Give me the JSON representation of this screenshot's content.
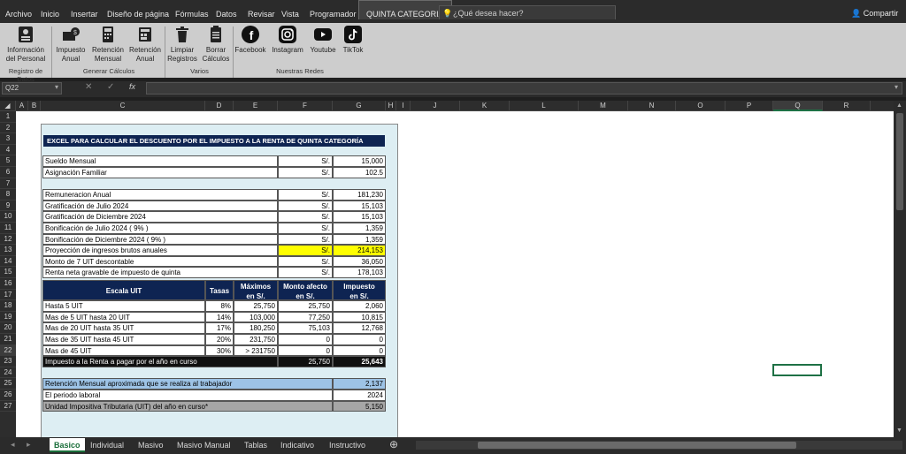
{
  "menubar": {
    "items": [
      "Archivo",
      "Inicio",
      "Insertar",
      "Diseño de página",
      "Fórmulas",
      "Datos",
      "Revisar",
      "Vista",
      "Programador",
      "QUINTA CATEGORIA"
    ],
    "search_placeholder": "¿Qué desea hacer?",
    "share_label": "Compartir"
  },
  "ribbon": {
    "buttons": [
      {
        "label1": "Información",
        "label2": "del Personal",
        "icon": "id-card-icon"
      },
      {
        "label1": "Impuesto",
        "label2": "Anual",
        "icon": "money-icon"
      },
      {
        "label1": "Retención",
        "label2": "Mensual",
        "icon": "calculator-icon"
      },
      {
        "label1": "Retención",
        "label2": "Anual",
        "icon": "calculator-stack-icon"
      },
      {
        "label1": "Limpiar",
        "label2": "Registros",
        "icon": "trash-icon"
      },
      {
        "label1": "Borrar",
        "label2": "Cálculos",
        "icon": "clipboard-icon"
      },
      {
        "label1": "Facebook",
        "label2": "",
        "icon": "facebook-icon"
      },
      {
        "label1": "Instagram",
        "label2": "",
        "icon": "instagram-icon"
      },
      {
        "label1": "Youtube",
        "label2": "",
        "icon": "youtube-icon"
      },
      {
        "label1": "TikTok",
        "label2": "",
        "icon": "tiktok-icon"
      }
    ],
    "groups": [
      "Registro de Datos",
      "Generar Cálculos",
      "Varios",
      "Nuestras Redes"
    ]
  },
  "formula_bar": {
    "name_box": "Q22",
    "formula": ""
  },
  "columns": [
    "A",
    "B",
    "C",
    "D",
    "E",
    "F",
    "G",
    "H",
    "I",
    "J",
    "K",
    "L",
    "M",
    "N",
    "O",
    "P",
    "Q",
    "R"
  ],
  "rows": [
    "1",
    "2",
    "3",
    "4",
    "5",
    "6",
    "7",
    "8",
    "9",
    "10",
    "11",
    "12",
    "13",
    "14",
    "15",
    "16",
    "17",
    "18",
    "19",
    "20",
    "21",
    "22",
    "23",
    "24",
    "25",
    "26",
    "27"
  ],
  "sheet": {
    "title": "EXCEL PARA CALCULAR EL DESCUENTO POR EL IMPUESTO A LA RENTA DE QUINTA CATEGORÍA",
    "currency": "S/.",
    "inputs": [
      {
        "label": "Sueldo Mensual",
        "value": "15,000"
      },
      {
        "label": "Asignación Familiar",
        "value": "102.5"
      }
    ],
    "income": [
      {
        "label": "Remuneracion Anual",
        "value": "181,230"
      },
      {
        "label": "Gratificación de Julio 2024",
        "value": "15,103"
      },
      {
        "label": "Gratificación de Diciembre 2024",
        "value": "15,103"
      },
      {
        "label": "Bonificación de Julio 2024 ( 9% )",
        "value": "1,359"
      },
      {
        "label": "Bonificación de Diciembre 2024 ( 9% )",
        "value": "1,359"
      },
      {
        "label": "Proyección de ingresos brutos anuales",
        "value": "214,153"
      },
      {
        "label": "Monto de 7 UIT descontable",
        "value": "36,050"
      },
      {
        "label": "Renta neta gravable de impuesto de quinta",
        "value": "178,103"
      }
    ],
    "scale_headers": {
      "escala": "Escala UIT",
      "tasas": "Tasas",
      "max1": "Máximos",
      "max2": "en S/.",
      "monto1": "Monto afecto",
      "monto2": "en S/.",
      "imp1": "Impuesto",
      "imp2": "en S/."
    },
    "scale_rows": [
      {
        "escala": "Hasta 5 UIT",
        "tasa": "8%",
        "max": "25,750",
        "monto": "25,750",
        "imp": "2,060"
      },
      {
        "escala": "Mas de 5 UIT hasta 20 UIT",
        "tasa": "14%",
        "max": "103,000",
        "monto": "77,250",
        "imp": "10,815"
      },
      {
        "escala": "Mas de 20 UIT hasta 35 UIT",
        "tasa": "17%",
        "max": "180,250",
        "monto": "75,103",
        "imp": "12,768"
      },
      {
        "escala": "Mas de 35 UIT hasta 45 UIT",
        "tasa": "20%",
        "max": "231,750",
        "monto": "0",
        "imp": "0"
      },
      {
        "escala": "Mas de 45 UIT",
        "tasa": "30%",
        "max": "> 231750",
        "monto": "0",
        "imp": "0"
      }
    ],
    "scale_total": {
      "label": "Impuesto a la Renta a pagar por el año en curso",
      "monto": "25,750",
      "imp": "25,643"
    },
    "summary": [
      {
        "label": "Retención Mensual aproximada que se realiza al trabajador",
        "value": "2,137"
      },
      {
        "label": "El periodo laboral",
        "value": "2024"
      },
      {
        "label": "Unidad Impositiva Tributaria (UIT) del año en curso*",
        "value": "5,150"
      }
    ]
  },
  "sheet_tabs": [
    "Basico",
    "Individual",
    "Masivo",
    "Masivo Manual",
    "Tablas",
    "Indicativo",
    "Instructivo"
  ],
  "active_tab": "Basico",
  "colors": {
    "accent_green": "#1e7145",
    "navy": "#0e2452",
    "highlight": "#ffff00",
    "summary_blue": "#9dc3e6"
  }
}
